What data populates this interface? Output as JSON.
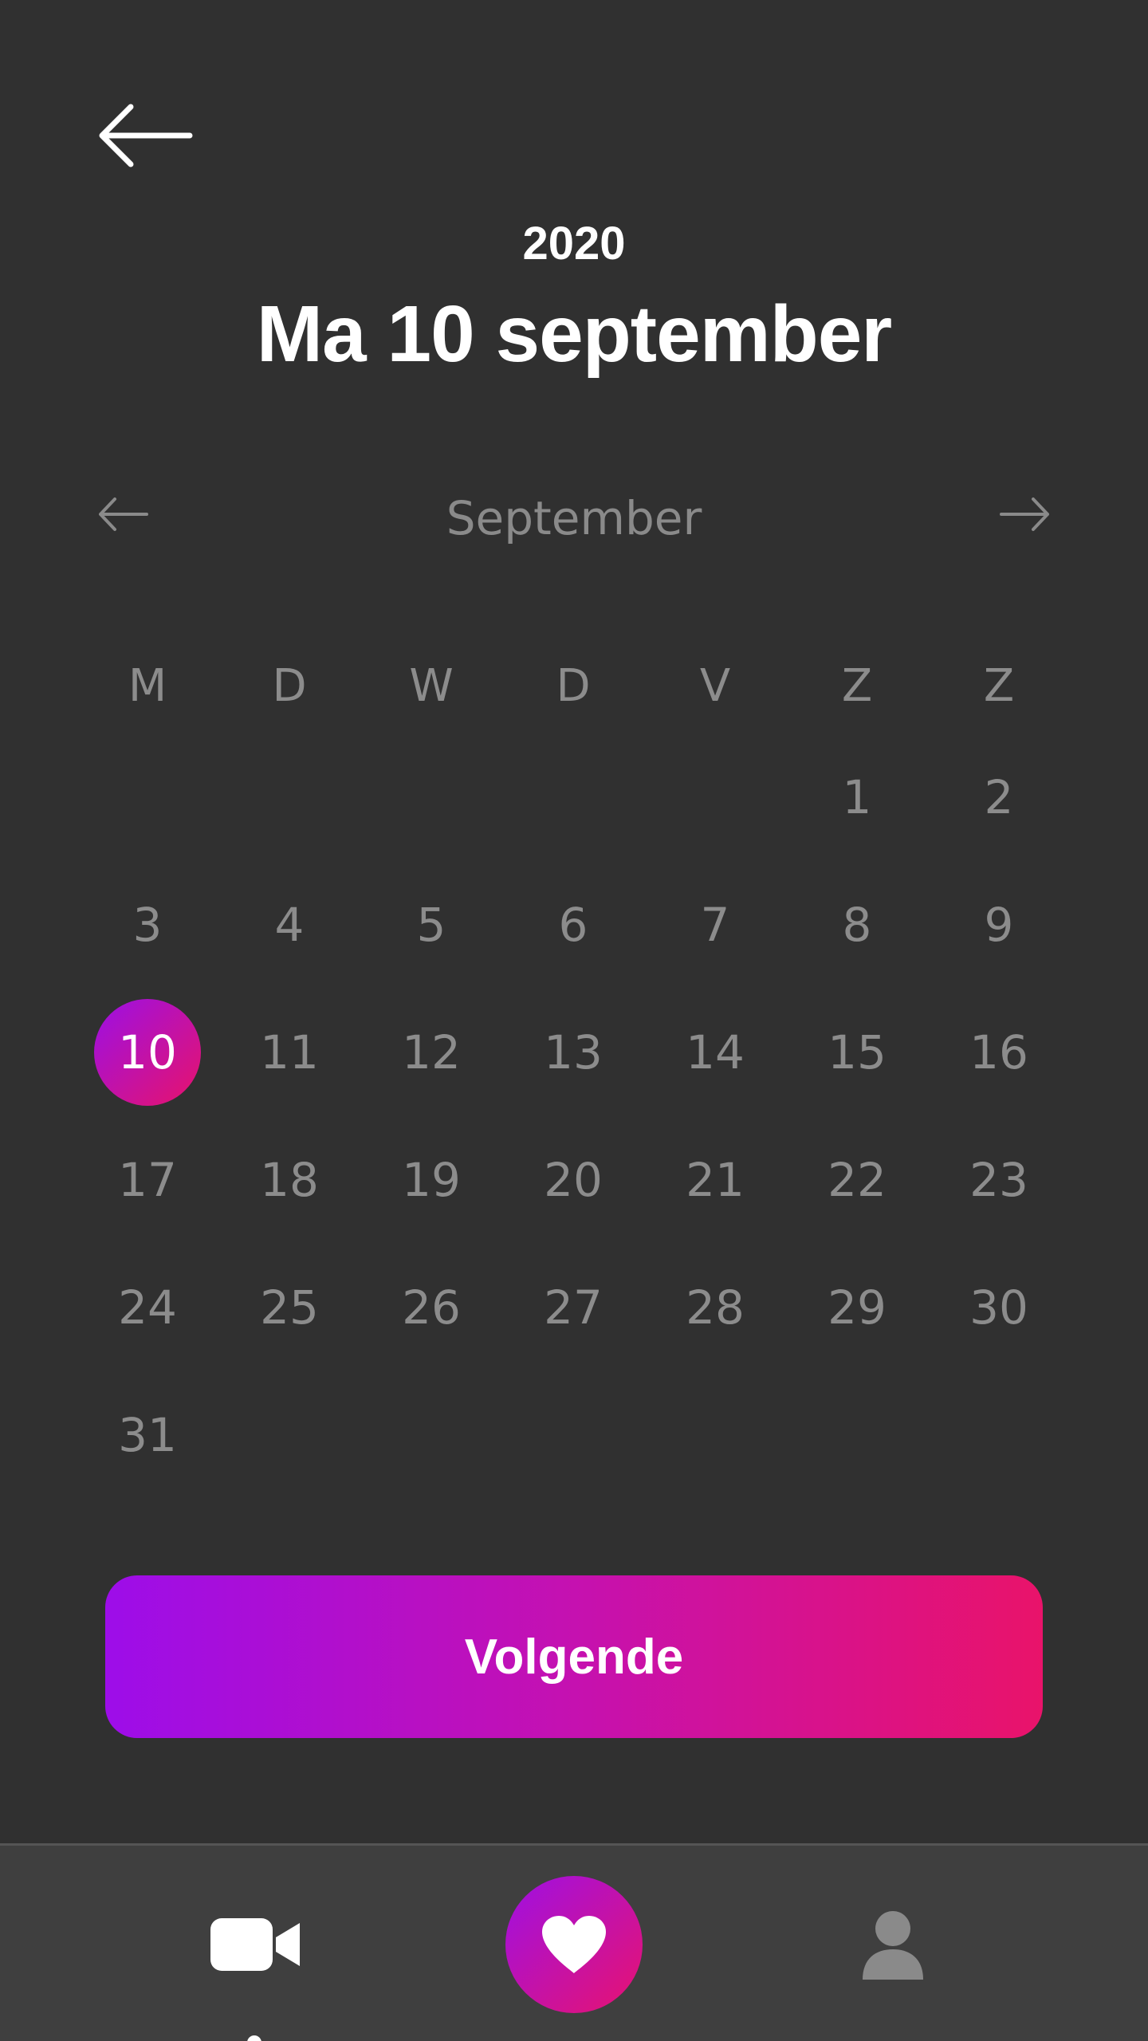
{
  "header": {
    "back_icon": "arrow-left-icon",
    "year": "2020",
    "date_title": "Ma 10 september"
  },
  "month_nav": {
    "prev_icon": "arrow-left-icon",
    "month": "September",
    "next_icon": "arrow-right-icon"
  },
  "calendar": {
    "weekdays": [
      "M",
      "D",
      "W",
      "D",
      "V",
      "Z",
      "Z"
    ],
    "weeks": [
      [
        "",
        "",
        "",
        "",
        "",
        "1",
        "2"
      ],
      [
        "3",
        "4",
        "5",
        "6",
        "7",
        "8",
        "9"
      ],
      [
        "10",
        "11",
        "12",
        "13",
        "14",
        "15",
        "16"
      ],
      [
        "17",
        "18",
        "19",
        "20",
        "21",
        "22",
        "23"
      ],
      [
        "24",
        "25",
        "26",
        "27",
        "28",
        "29",
        "30"
      ],
      [
        "31",
        "",
        "",
        "",
        "",
        "",
        ""
      ]
    ],
    "selected_day": "10"
  },
  "actions": {
    "next_label": "Volgende"
  },
  "tab_bar": {
    "items": [
      {
        "icon": "video-camera-icon",
        "active": true
      },
      {
        "icon": "heart-icon",
        "active": false
      },
      {
        "icon": "profile-icon",
        "active": false
      }
    ]
  },
  "colors": {
    "background": "#303030",
    "tab_bar": "#3f3f3f",
    "muted_text": "#8c8c8c",
    "gradient_start": "#9b10e6",
    "gradient_end": "#e8136a"
  }
}
